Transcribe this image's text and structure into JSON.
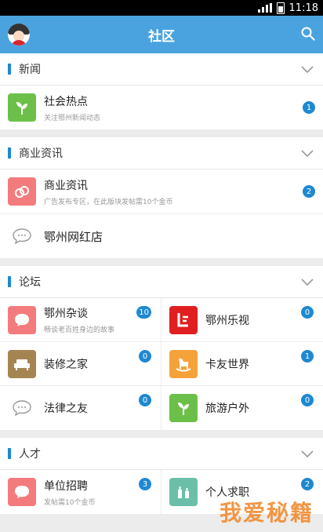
{
  "status": {
    "time": "11:18"
  },
  "header": {
    "title": "社区"
  },
  "sections": {
    "news": {
      "title": "新闻",
      "items": [
        {
          "name": "社会热点",
          "sub": "关注鄂州新闻动态",
          "badge": "1"
        }
      ]
    },
    "business": {
      "title": "商业资讯",
      "items": [
        {
          "name": "商业资讯",
          "sub": "广告发布专区，在此版块发帖需10个金币",
          "badge": "2"
        },
        {
          "name": "鄂州网红店"
        }
      ]
    },
    "forum": {
      "title": "论坛",
      "items": [
        {
          "name": "鄂州杂谈",
          "sub": "畅谈老百姓身边的故事",
          "badge": "10"
        },
        {
          "name": "鄂州乐视",
          "badge": "0"
        },
        {
          "name": "装修之家",
          "badge": "0"
        },
        {
          "name": "卡友世界",
          "badge": "1"
        },
        {
          "name": "法律之友",
          "badge": "0"
        },
        {
          "name": "旅游户外",
          "badge": "0"
        }
      ]
    },
    "talent": {
      "title": "人才",
      "items": [
        {
          "name": "单位招聘",
          "sub": "发帖需10个金币",
          "badge": "3"
        },
        {
          "name": "个人求职",
          "badge": "2"
        }
      ]
    }
  },
  "watermark": "我爱秘籍"
}
